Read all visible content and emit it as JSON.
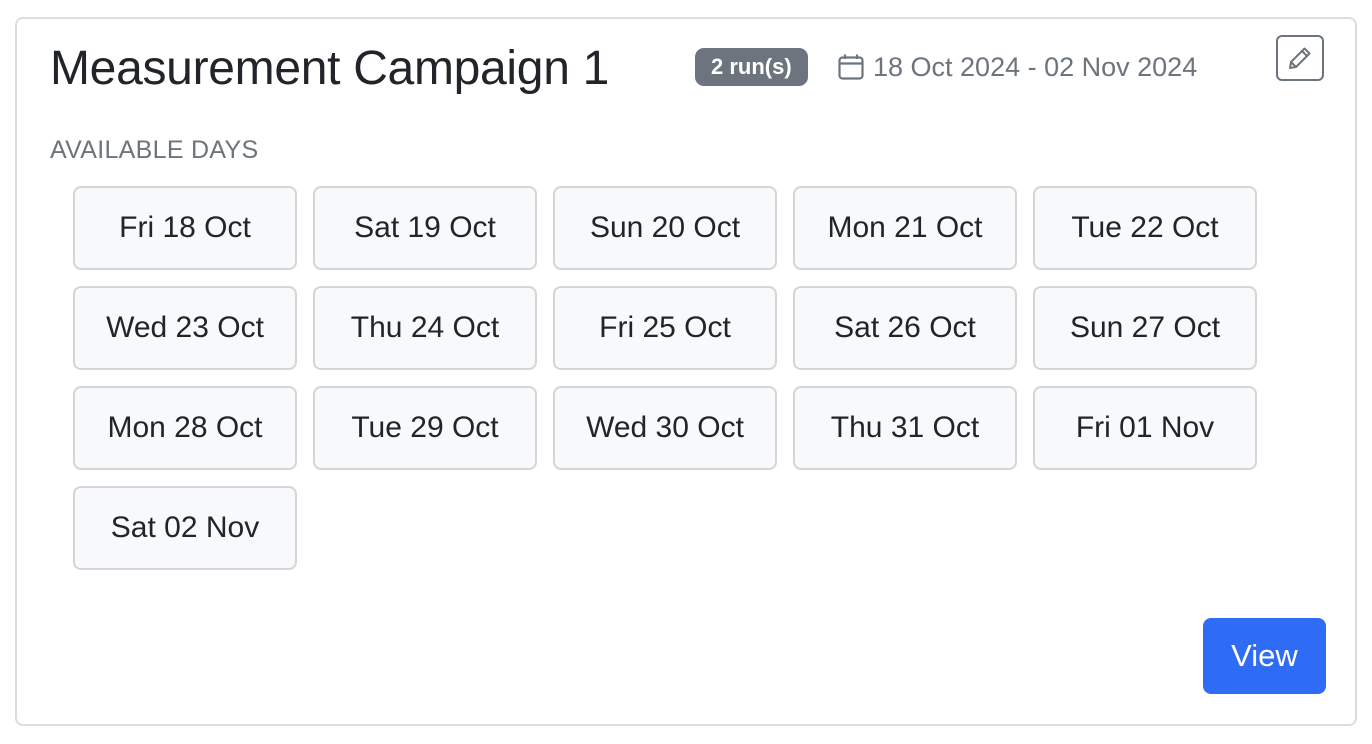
{
  "campaign": {
    "title": "Measurement Campaign 1",
    "runs_badge": "2 run(s)",
    "date_range": "18 Oct 2024 - 02 Nov 2024"
  },
  "available_days": {
    "label": "AVAILABLE DAYS",
    "days": [
      "Fri 18 Oct",
      "Sat 19 Oct",
      "Sun 20 Oct",
      "Mon 21 Oct",
      "Tue 22 Oct",
      "Wed 23 Oct",
      "Thu 24 Oct",
      "Fri 25 Oct",
      "Sat 26 Oct",
      "Sun 27 Oct",
      "Mon 28 Oct",
      "Tue 29 Oct",
      "Wed 30 Oct",
      "Thu 31 Oct",
      "Fri 01 Nov",
      "Sat 02 Nov"
    ]
  },
  "actions": {
    "view_label": "View"
  },
  "icons": {
    "calendar": "calendar-icon",
    "edit": "pencil-icon"
  },
  "colors": {
    "primary": "#2f6cf6",
    "badge_bg": "#6c757d",
    "muted_text": "#6c757d",
    "day_button_bg": "#f8f9fa"
  }
}
